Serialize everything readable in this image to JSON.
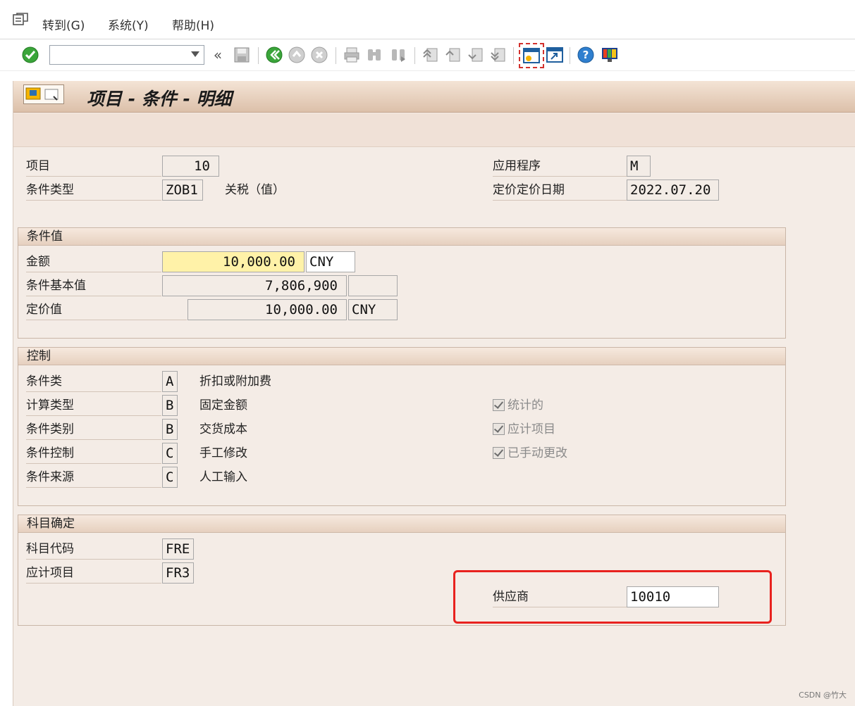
{
  "menu": {
    "items": [
      "转到(G)",
      "系统(Y)",
      "帮助(H)"
    ]
  },
  "toolbar": {
    "command_value": "",
    "back_glyph": "«",
    "icons": [
      "enter-check-icon",
      "save-icon",
      "back-icon",
      "exit-icon",
      "cancel-icon",
      "print-icon",
      "find-icon",
      "find-next-icon",
      "first-page-icon",
      "prev-page-icon",
      "next-page-icon",
      "last-page-icon",
      "new-session-icon",
      "shortcut-icon",
      "help-icon",
      "layout-icon"
    ]
  },
  "title": "项目 - 条件 - 明细",
  "header": {
    "item_label": "项目",
    "item_value": "10",
    "cond_type_label": "条件类型",
    "cond_type_value": "ZOB1",
    "cond_type_desc": "关税（值）",
    "app_label": "应用程序",
    "app_value": "M",
    "pricing_date_label": "定价定价日期",
    "pricing_date_value": "2022.07.20"
  },
  "cond_values": {
    "title": "条件值",
    "amount_label": "金额",
    "amount_value": "10,000.00",
    "amount_currency": "CNY",
    "base_label": "条件基本值",
    "base_value": "7,806,900",
    "base_unit": "",
    "value_label": "定价值",
    "value_value": "10,000.00",
    "value_currency": "CNY"
  },
  "control": {
    "title": "控制",
    "rows": [
      {
        "label": "条件类",
        "code": "A",
        "desc": "折扣或附加费"
      },
      {
        "label": "计算类型",
        "code": "B",
        "desc": "固定金额"
      },
      {
        "label": "条件类别",
        "code": "B",
        "desc": "交货成本"
      },
      {
        "label": "条件控制",
        "code": "C",
        "desc": "手工修改"
      },
      {
        "label": "条件来源",
        "code": "C",
        "desc": "人工输入"
      }
    ],
    "checks": [
      "统计的",
      "应计项目",
      "已手动更改"
    ]
  },
  "account": {
    "title": "科目确定",
    "code_label": "科目代码",
    "code_value": "FRE",
    "accrual_label": "应计项目",
    "accrual_value": "FR3",
    "vendor_label": "供应商",
    "vendor_value": "10010"
  },
  "watermark": "CSDN @竹大",
  "colors": {
    "screen_bg": "#f4ece6",
    "highlight_yellow": "#fff2a8",
    "frame_red": "#e8221f"
  }
}
